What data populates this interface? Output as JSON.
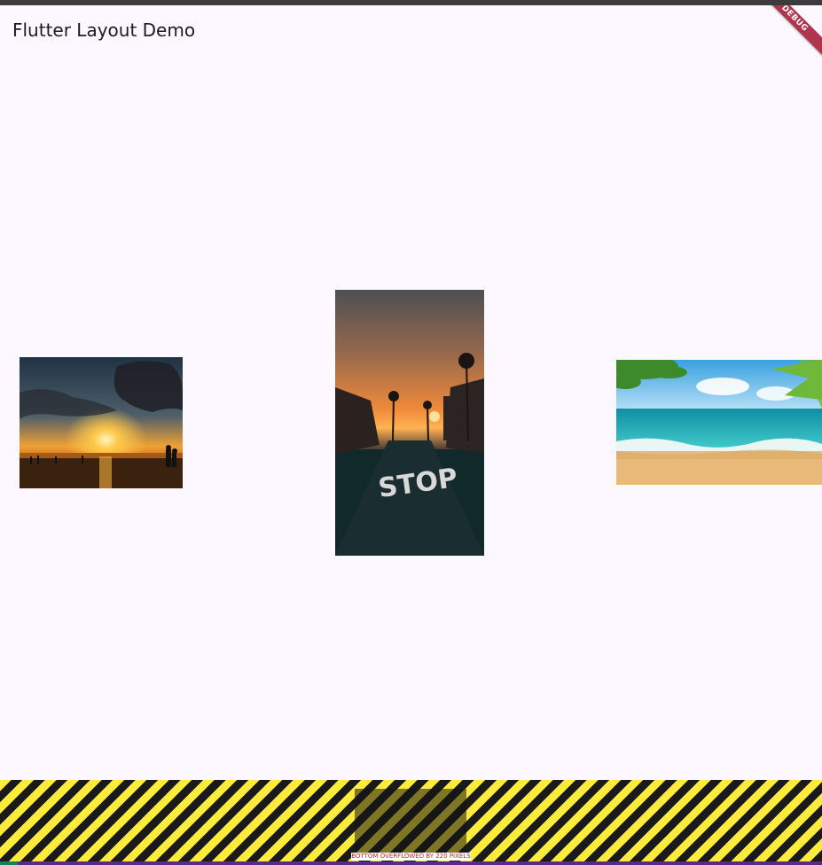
{
  "app": {
    "title": "Flutter Layout Demo",
    "debug_banner": "DEBUG"
  },
  "images": {
    "left": {
      "icon": "sunset-photo"
    },
    "center": {
      "icon": "stop-street-photo"
    },
    "right": {
      "icon": "beach-photo"
    }
  },
  "overflow": {
    "message": "BOTTOM OVERFLOWED BY 220 PIXELS"
  },
  "colors": {
    "background": "#fdf7ff",
    "debug_banner": "#b0344d",
    "overflow_yellow": "#ffeb3b",
    "overflow_black": "#1a1a1a",
    "overflow_text": "#c62828"
  }
}
